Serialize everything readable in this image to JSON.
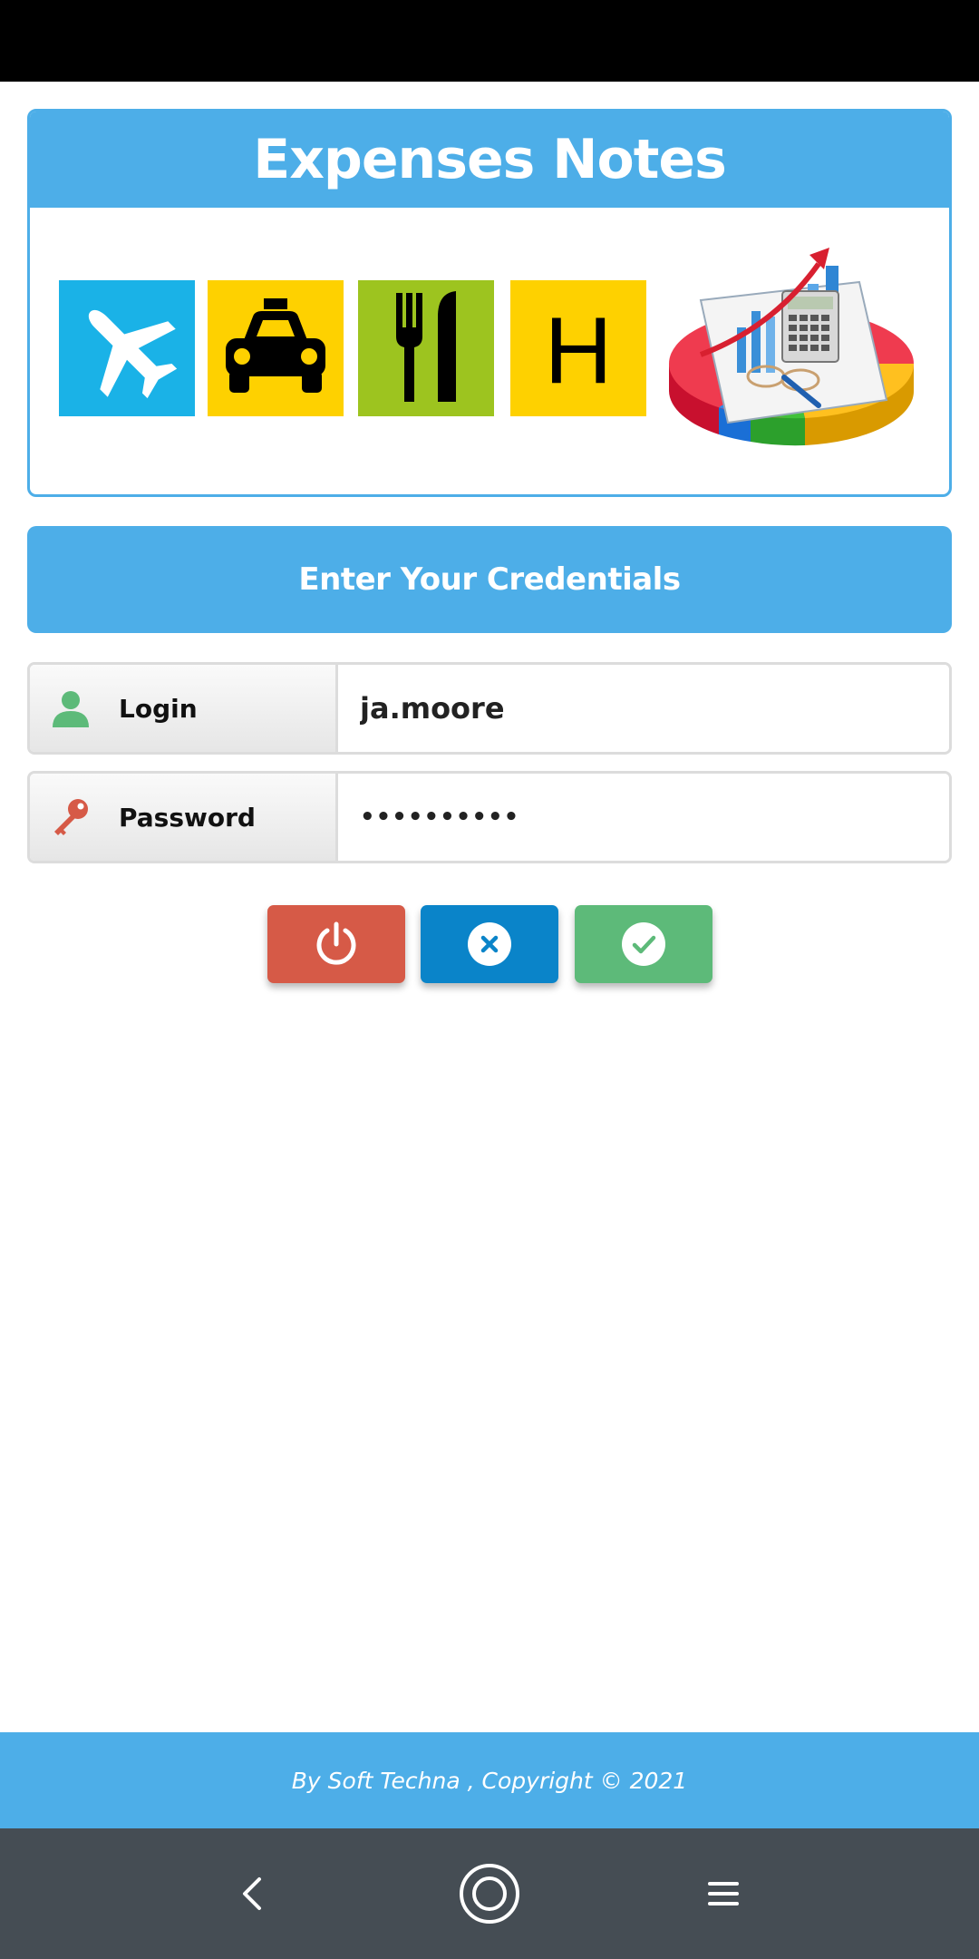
{
  "app": {
    "title": "Expenses Notes"
  },
  "banner": {
    "icons": [
      "airplane-icon",
      "taxi-icon",
      "fork-knife-icon",
      "hotel-icon",
      "finance-chart-icon"
    ],
    "hotel_letter": "H",
    "colors": {
      "flight": "#1ab2e7",
      "taxi": "#fed100",
      "meal": "#9dc41f",
      "hotel": "#fed100"
    }
  },
  "credentials": {
    "heading": "Enter Your Credentials"
  },
  "form": {
    "login_label": "Login",
    "login_value": "ja.moore",
    "password_label": "Password",
    "password_value": "••••••••••",
    "login_icon": "user-icon",
    "password_icon": "key-icon"
  },
  "actions": [
    {
      "name": "power",
      "icon": "power-icon",
      "color": "#d65a47"
    },
    {
      "name": "cancel",
      "icon": "close-circle-icon",
      "color": "#0a84c9"
    },
    {
      "name": "confirm",
      "icon": "check-circle-icon",
      "color": "#5dba79"
    }
  ],
  "footer": {
    "text": "By Soft Techna , Copyright © 2021"
  },
  "theme": {
    "accent": "#4daee8",
    "nav_bar": "#454d54"
  }
}
